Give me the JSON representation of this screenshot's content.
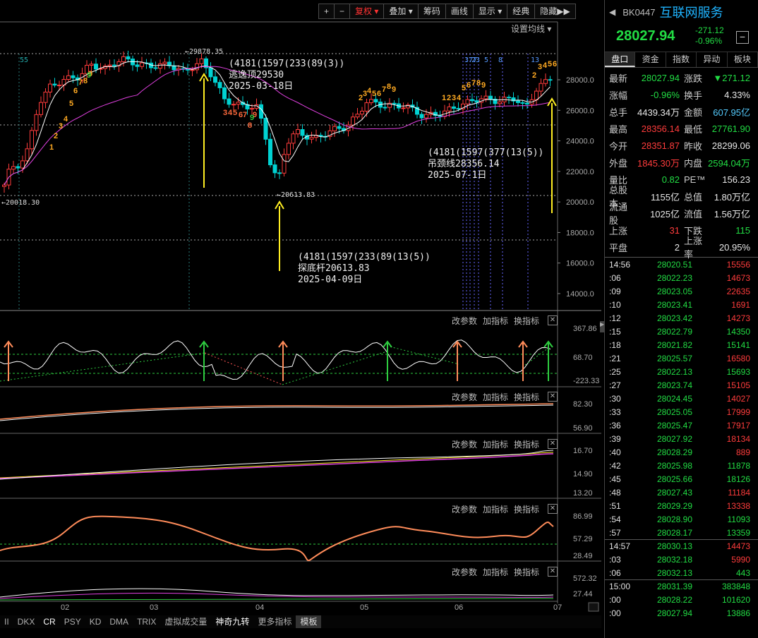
{
  "toolbar": {
    "buttons": [
      "+",
      "−",
      "复权",
      "叠加",
      "筹码",
      "画线",
      "显示",
      "经典",
      "隐藏"
    ],
    "more": "▶▶"
  },
  "ma_setting": "设置均线",
  "panel_links": [
    "改参数",
    "加指标",
    "换指标"
  ],
  "main": {
    "y_ticks": [
      "28000.0",
      "26000.0",
      "24000.0",
      "22000.0",
      "20000.0",
      "18000.0",
      "16000.0",
      "14000.0"
    ],
    "peak_label": "←29878.35",
    "low_label": "←20018.30",
    "bottom_label": "←20613.83",
    "top_counts": [
      "55"
    ],
    "late_counts": [
      "377",
      "23",
      "5",
      "8",
      "13"
    ],
    "annotations": [
      {
        "code": "(4181(1597(233(89(3))",
        "name": "逃逸顶29530",
        "date": "2025-03-18日"
      },
      {
        "code": "(4181(1597(233(89(13(5))",
        "name": "探底杆20613.83",
        "date": "2025-04-09日"
      },
      {
        "code": "(4181(1597(377(13(5))",
        "name": "吊颈线28356.14",
        "date": "2025-07-1日"
      }
    ],
    "seq_labels": [
      "1",
      "2",
      "3",
      "4",
      "5",
      "6",
      "7",
      "8",
      "9",
      "3",
      "4",
      "5",
      "6",
      "7",
      "8",
      "9",
      "2",
      "3",
      "4",
      "5",
      "6",
      "7",
      "8",
      "9",
      "1",
      "2",
      "3",
      "4",
      "5",
      "6",
      "7",
      "8",
      "9",
      "2",
      "3",
      "4",
      "5",
      "6"
    ]
  },
  "panels": [
    {
      "ticks": [
        "367.86",
        "68.70",
        "-223.33"
      ]
    },
    {
      "ticks": [
        "82.30",
        "56.90"
      ]
    },
    {
      "ticks": [
        "16.70",
        "14.90",
        "13.20"
      ]
    },
    {
      "ticks": [
        "86.99",
        "57.29",
        "28.49"
      ]
    },
    {
      "ticks": [
        "572.32",
        "27.44"
      ]
    }
  ],
  "x_axis": [
    "02",
    "03",
    "04",
    "05",
    "06",
    "07"
  ],
  "bottom_tabs": [
    "II",
    "DKX",
    "CR",
    "PSY",
    "KD",
    "DMA",
    "TRIX",
    "虚拟成交量",
    "神奇九转",
    "更多指标",
    "模板"
  ],
  "side": {
    "code": "BK0447",
    "name": "互联网服务",
    "price": "28027.94",
    "change": "-271.12",
    "change_pct": "-0.96%",
    "minus_btn": "−",
    "tabs": [
      "盘口",
      "资金",
      "指数",
      "异动",
      "板块"
    ],
    "stats": [
      {
        "l": "最新",
        "v": "28027.94",
        "vc": "green",
        "l2": "涨跌",
        "v2": "▼271.12",
        "v2c": "green"
      },
      {
        "l": "涨幅",
        "v": "-0.96%",
        "vc": "green",
        "l2": "换手",
        "v2": "4.33%",
        "v2c": "white"
      },
      {
        "l": "总手",
        "v": "4439.34万",
        "vc": "white",
        "l2": "金额",
        "v2": "607.95亿",
        "v2c": "cyan"
      },
      {
        "l": "最高",
        "v": "28356.14",
        "vc": "red",
        "l2": "最低",
        "v2": "27761.90",
        "v2c": "green"
      },
      {
        "l": "今开",
        "v": "28351.87",
        "vc": "red",
        "l2": "昨收",
        "v2": "28299.06",
        "v2c": "white"
      },
      {
        "l": "外盘",
        "v": "1845.30万",
        "vc": "red",
        "l2": "内盘",
        "v2": "2594.04万",
        "v2c": "green"
      },
      {
        "l": "量比",
        "v": "0.82",
        "vc": "green",
        "l2": "PE™",
        "v2": "156.23",
        "v2c": "white"
      },
      {
        "l": "总股本",
        "v": "1155亿",
        "vc": "white",
        "l2": "总值",
        "v2": "1.80万亿",
        "v2c": "white"
      },
      {
        "l": "流通股",
        "v": "1025亿",
        "vc": "white",
        "l2": "流值",
        "v2": "1.56万亿",
        "v2c": "white"
      },
      {
        "l": "上涨",
        "v": "31",
        "vc": "red",
        "l2": "下跌",
        "v2": "115",
        "v2c": "green"
      },
      {
        "l": "平盘",
        "v": "2",
        "vc": "white",
        "l2": "上涨率",
        "v2": "20.95%",
        "v2c": "white"
      }
    ],
    "ticks": [
      {
        "t": "14:56",
        "p": "28020.51",
        "v": "15556",
        "c": "red"
      },
      {
        "t": ":06",
        "p": "28022.23",
        "v": "14673",
        "c": "red"
      },
      {
        "t": ":09",
        "p": "28023.05",
        "v": "22635",
        "c": "red"
      },
      {
        "t": ":10",
        "p": "28023.41",
        "v": "1691",
        "c": "red"
      },
      {
        "t": ":12",
        "p": "28023.42",
        "v": "14273",
        "c": "red"
      },
      {
        "t": ":15",
        "p": "28022.79",
        "v": "14350",
        "c": "green"
      },
      {
        "t": ":18",
        "p": "28021.82",
        "v": "15141",
        "c": "green"
      },
      {
        "t": ":21",
        "p": "28025.57",
        "v": "16580",
        "c": "red"
      },
      {
        "t": ":25",
        "p": "28022.13",
        "v": "15693",
        "c": "green"
      },
      {
        "t": ":27",
        "p": "28023.74",
        "v": "15105",
        "c": "red"
      },
      {
        "t": ":30",
        "p": "28024.45",
        "v": "14027",
        "c": "red"
      },
      {
        "t": ":33",
        "p": "28025.05",
        "v": "17999",
        "c": "red"
      },
      {
        "t": ":36",
        "p": "28025.47",
        "v": "17917",
        "c": "red"
      },
      {
        "t": ":39",
        "p": "28027.92",
        "v": "18134",
        "c": "red"
      },
      {
        "t": ":40",
        "p": "28028.29",
        "v": "889",
        "c": "red"
      },
      {
        "t": ":42",
        "p": "28025.98",
        "v": "11878",
        "c": "green"
      },
      {
        "t": ":45",
        "p": "28025.66",
        "v": "18126",
        "c": "green"
      },
      {
        "t": ":48",
        "p": "28027.43",
        "v": "11184",
        "c": "red"
      },
      {
        "t": ":51",
        "p": "28029.29",
        "v": "13338",
        "c": "red"
      },
      {
        "t": ":54",
        "p": "28028.90",
        "v": "11093",
        "c": "green"
      },
      {
        "t": ":57",
        "p": "28028.17",
        "v": "13359",
        "c": "green"
      },
      {
        "t": "14:57",
        "p": "28030.13",
        "v": "14473",
        "c": "red",
        "sep": true
      },
      {
        "t": ":03",
        "p": "28032.18",
        "v": "5990",
        "c": "red"
      },
      {
        "t": ":06",
        "p": "28032.13",
        "v": "443",
        "c": "green"
      },
      {
        "t": "15:00",
        "p": "28031.39",
        "v": "383848",
        "c": "green",
        "sep": true
      },
      {
        "t": ":00",
        "p": "28028.22",
        "v": "101620",
        "c": "green"
      },
      {
        "t": ":00",
        "p": "28027.94",
        "v": "13886",
        "c": "green"
      }
    ]
  }
}
